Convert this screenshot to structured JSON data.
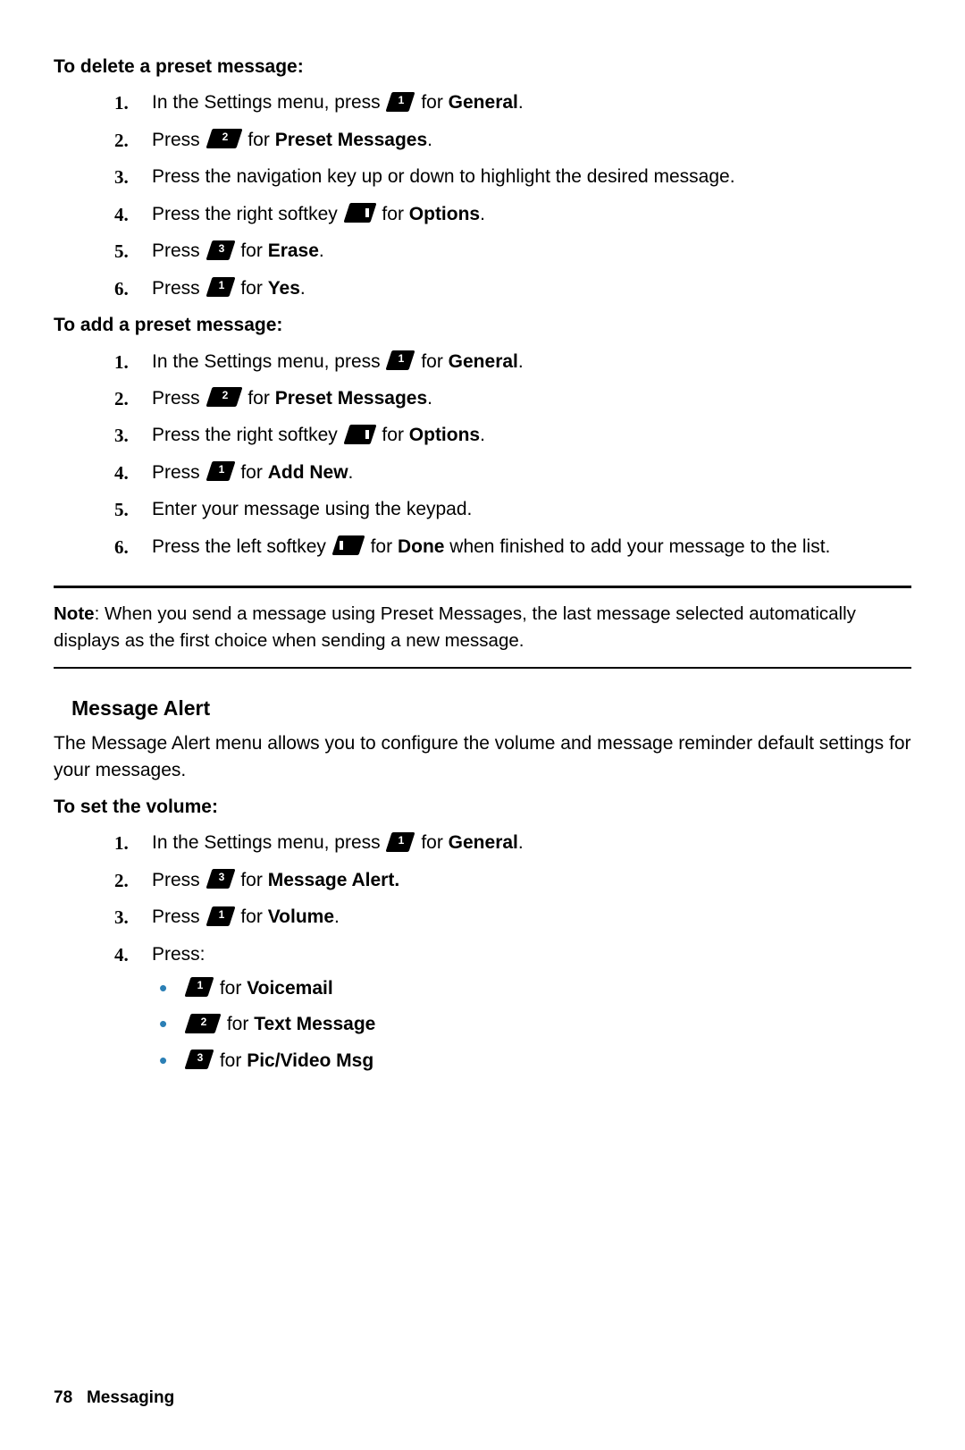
{
  "sections": {
    "delete": {
      "title": "To delete a preset message:",
      "s1a": "In the Settings menu, press ",
      "s1b": " for ",
      "s1c": "General",
      "s1d": ".",
      "s2a": "Press ",
      "s2b": " for ",
      "s2c": "Preset Messages",
      "s2d": ".",
      "s3": "Press the navigation key up or down to highlight the desired message.",
      "s4a": "Press the right softkey ",
      "s4b": " for ",
      "s4c": "Options",
      "s4d": ".",
      "s5a": "Press ",
      "s5b": " for ",
      "s5c": "Erase",
      "s5d": ".",
      "s6a": "Press ",
      "s6b": " for ",
      "s6c": "Yes",
      "s6d": "."
    },
    "add": {
      "title": "To add a preset message:",
      "s1a": "In the Settings menu, press ",
      "s1b": " for ",
      "s1c": "General",
      "s1d": ".",
      "s2a": "Press ",
      "s2b": " for ",
      "s2c": "Preset Messages",
      "s2d": ".",
      "s3a": "Press the right softkey ",
      "s3b": " for ",
      "s3c": "Options",
      "s3d": ".",
      "s4a": "Press ",
      "s4b": " for ",
      "s4c": "Add New",
      "s4d": ".",
      "s5": "Enter your message using the keypad.",
      "s6a": "Press the left softkey ",
      "s6b": " for ",
      "s6c": "Done",
      "s6d": " when finished to add your message to the list."
    },
    "note": {
      "label": "Note",
      "text": ": When you send a message using Preset Messages, the last message selected automatically displays as the first choice when sending a new message."
    },
    "alert": {
      "title": "Message Alert",
      "intro": "The Message Alert menu allows you to configure the volume and message reminder default settings for your messages."
    },
    "volume": {
      "title": "To set the volume:",
      "s1a": "In the Settings menu, press ",
      "s1b": " for ",
      "s1c": "General",
      "s1d": ".",
      "s2a": "Press ",
      "s2b": " for ",
      "s2c": "Message Alert.",
      "s3a": "Press ",
      "s3b": " for ",
      "s3c": "Volume",
      "s3d": ".",
      "s4": "Press:",
      "b1a": " for ",
      "b1b": "Voicemail",
      "b2a": " for ",
      "b2b": "Text Message",
      "b3a": " for ",
      "b3b": "Pic/Video Msg"
    }
  },
  "keys": {
    "k1": "1",
    "k2": "2",
    "k3": "3"
  },
  "nums": {
    "n1": "1.",
    "n2": "2.",
    "n3": "3.",
    "n4": "4.",
    "n5": "5.",
    "n6": "6."
  },
  "footer": {
    "page": "78",
    "section": "Messaging"
  }
}
